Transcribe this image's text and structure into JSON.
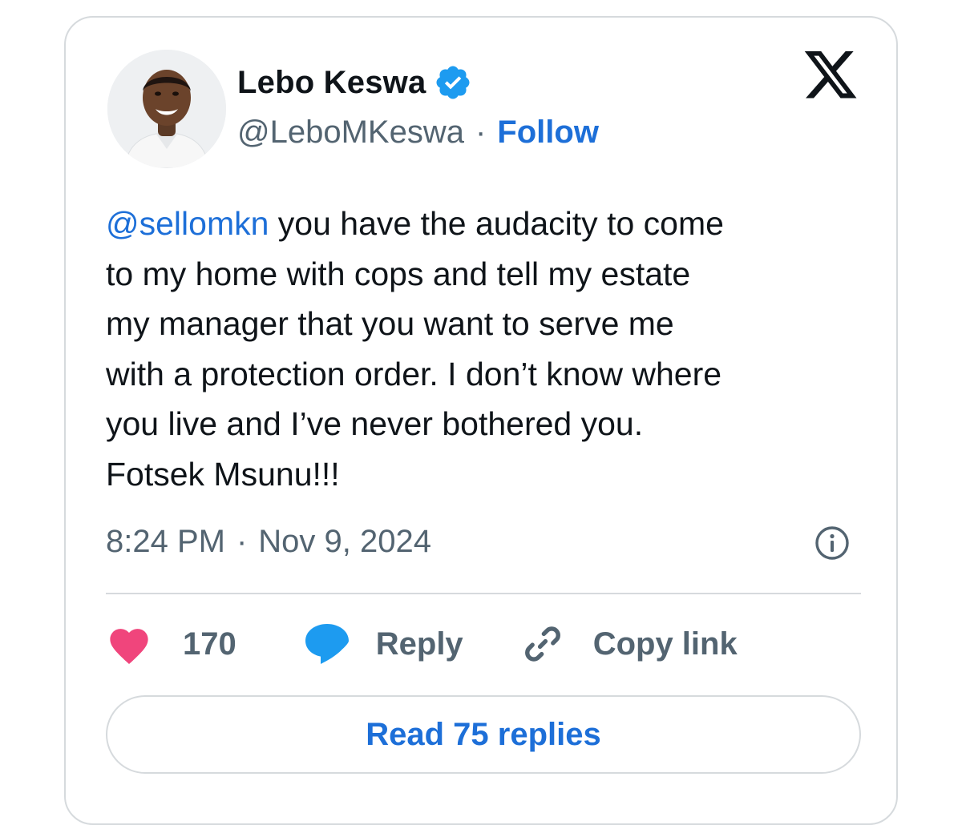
{
  "author": {
    "display_name": "Lebo Keswa",
    "handle": "@LeboMKeswa",
    "separator": "·",
    "follow_label": "Follow",
    "verified": true
  },
  "tweet": {
    "mention": "@sellomkn",
    "body": " you have the audacity to come\nto my home with cops and tell my estate\nmy manager that you want to serve me\nwith a protection order. I don’t know where\nyou live and I’ve never bothered you.\nFotsek Msunu!!!",
    "time": "8:24 PM",
    "date_separator": "·",
    "date": "Nov 9, 2024"
  },
  "actions": {
    "like_count": "170",
    "reply_label": "Reply",
    "copy_link_label": "Copy link"
  },
  "read_replies_label": "Read 75 replies",
  "icons": {
    "verified": "verified-badge-icon",
    "x_logo": "x-logo-icon",
    "info": "info-icon",
    "like": "heart-icon",
    "reply": "speech-bubble-icon",
    "copy_link": "link-icon"
  },
  "colors": {
    "accent": "#1d6fd8",
    "heart": "#f0457c",
    "muted": "#536471",
    "border": "#d6dadd",
    "verified": "#1d9bf0"
  }
}
